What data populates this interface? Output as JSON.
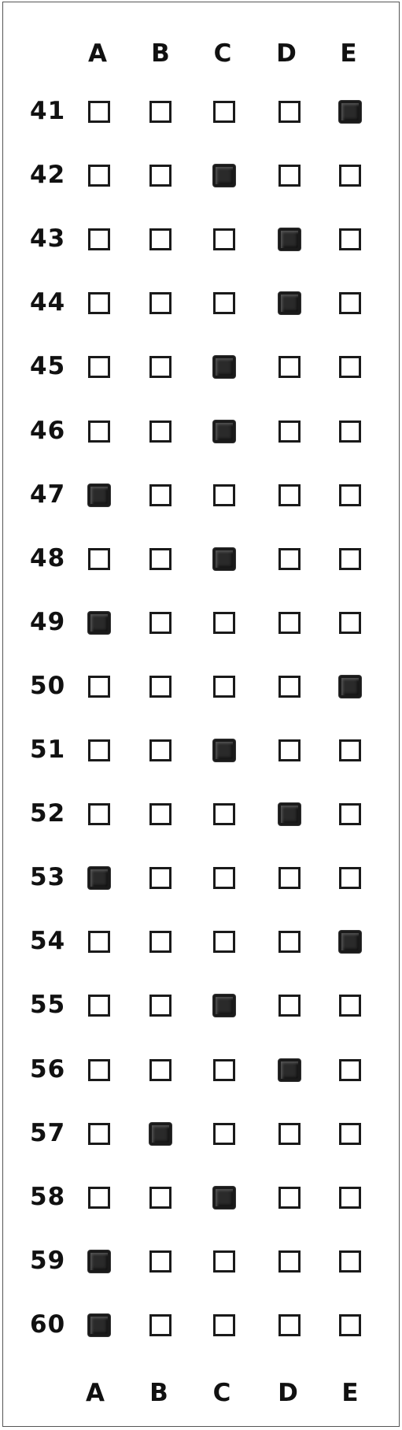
{
  "columns": [
    "A",
    "B",
    "C",
    "D",
    "E"
  ],
  "rows": [
    {
      "number": "41",
      "answer": "E"
    },
    {
      "number": "42",
      "answer": "C"
    },
    {
      "number": "43",
      "answer": "D"
    },
    {
      "number": "44",
      "answer": "D"
    },
    {
      "number": "45",
      "answer": "C"
    },
    {
      "number": "46",
      "answer": "C"
    },
    {
      "number": "47",
      "answer": "A"
    },
    {
      "number": "48",
      "answer": "C"
    },
    {
      "number": "49",
      "answer": "A"
    },
    {
      "number": "50",
      "answer": "E"
    },
    {
      "number": "51",
      "answer": "C"
    },
    {
      "number": "52",
      "answer": "D"
    },
    {
      "number": "53",
      "answer": "A"
    },
    {
      "number": "54",
      "answer": "E"
    },
    {
      "number": "55",
      "answer": "C"
    },
    {
      "number": "56",
      "answer": "D"
    },
    {
      "number": "57",
      "answer": "B"
    },
    {
      "number": "58",
      "answer": "C"
    },
    {
      "number": "59",
      "answer": "A"
    },
    {
      "number": "60",
      "answer": "A"
    }
  ],
  "colors": {
    "ink": "#1a1a1a",
    "fill": "#2a2a2a",
    "border": "#555555"
  }
}
